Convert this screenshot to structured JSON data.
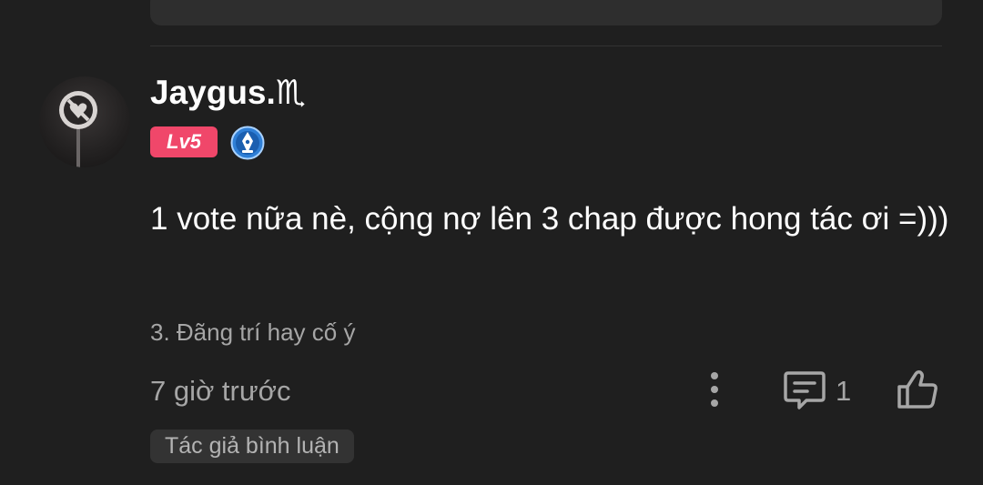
{
  "comment": {
    "username": "Jaygus.♏",
    "level_badge": "Lv5",
    "medal_icon": "blue-pen-medal-icon",
    "avatar_icon": "no-heart-sign-avatar",
    "content": "1 vote nữa nè, cộng nợ lên 3 chap được hong tác ơi =)))",
    "chapter_ref": "3. Đãng trí hay cố ý",
    "timestamp": "7 giờ trước",
    "reply_count": "1",
    "tag_label": "Tác giả bình luận"
  },
  "colors": {
    "background": "#1f1f1f",
    "level_badge": "#f0476a",
    "muted_text": "#a6a6a6",
    "medal_blue": "#3b8de0"
  }
}
